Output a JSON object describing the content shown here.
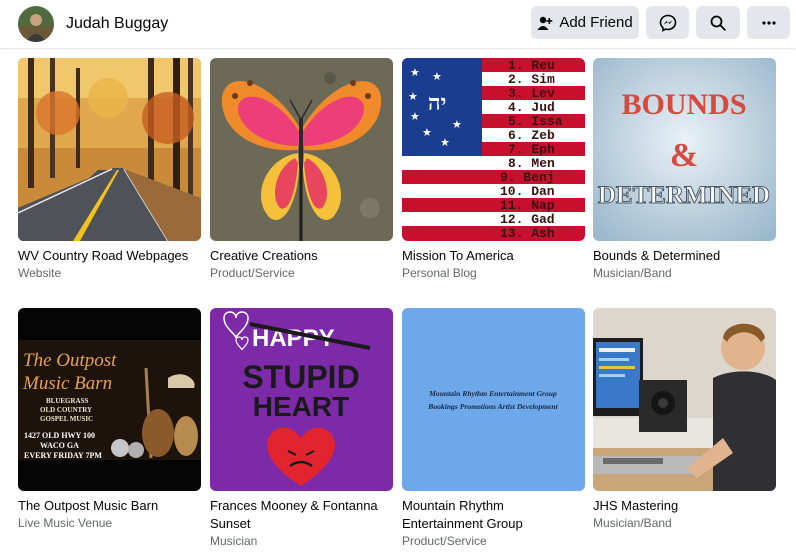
{
  "profile": {
    "name": "Judah Buggay"
  },
  "actions": {
    "add_friend": "Add Friend",
    "messenger_icon": "messenger-icon",
    "search_icon": "search-icon",
    "more_icon": "more-icon"
  },
  "thumb_text": {
    "mission_list": [
      "1. Reu",
      "2. Sim",
      "3. Lev",
      "4. Jud",
      "5. Issa",
      "6. Zeb",
      "7. Eph",
      "8. Men",
      "9. Benj",
      "10. Dan",
      "11. Nap",
      "12. Gad",
      "13. Ash"
    ],
    "bounds_line1": "BOUNDS",
    "bounds_amp": "&",
    "bounds_line2": "DETERMINED",
    "outpost_title1": "The Outpost",
    "outpost_title2": "Music Barn",
    "outpost_genre1": "BLUEGRASS",
    "outpost_genre2": "OLD COUNTRY",
    "outpost_genre3": "GOSPEL MUSIC",
    "outpost_addr1": "1427 OLD HWY 100",
    "outpost_addr2": "WACO GA",
    "outpost_addr3": "EVERY FRIDAY 7PM",
    "frances_happy": "HAPPY",
    "frances_stupid": "STUPID",
    "frances_heart": "HEART",
    "mountain_line1": "Mountain Rhythm Entertainment Group",
    "mountain_line2": "Bookings Promotions Artist Development"
  },
  "pages": [
    {
      "title": "WV Country Road Webpages",
      "category": "Website"
    },
    {
      "title": "Creative Creations",
      "category": "Product/Service"
    },
    {
      "title": "Mission To America",
      "category": "Personal Blog"
    },
    {
      "title": "Bounds & Determined",
      "category": "Musician/Band"
    },
    {
      "title": "The Outpost Music Barn",
      "category": "Live Music Venue"
    },
    {
      "title": "Frances Mooney & Fontanna Sunset",
      "category": "Musician"
    },
    {
      "title": "Mountain Rhythm Entertainment Group",
      "category": "Product/Service"
    },
    {
      "title": "JHS Mastering",
      "category": "Musician/Band"
    }
  ]
}
